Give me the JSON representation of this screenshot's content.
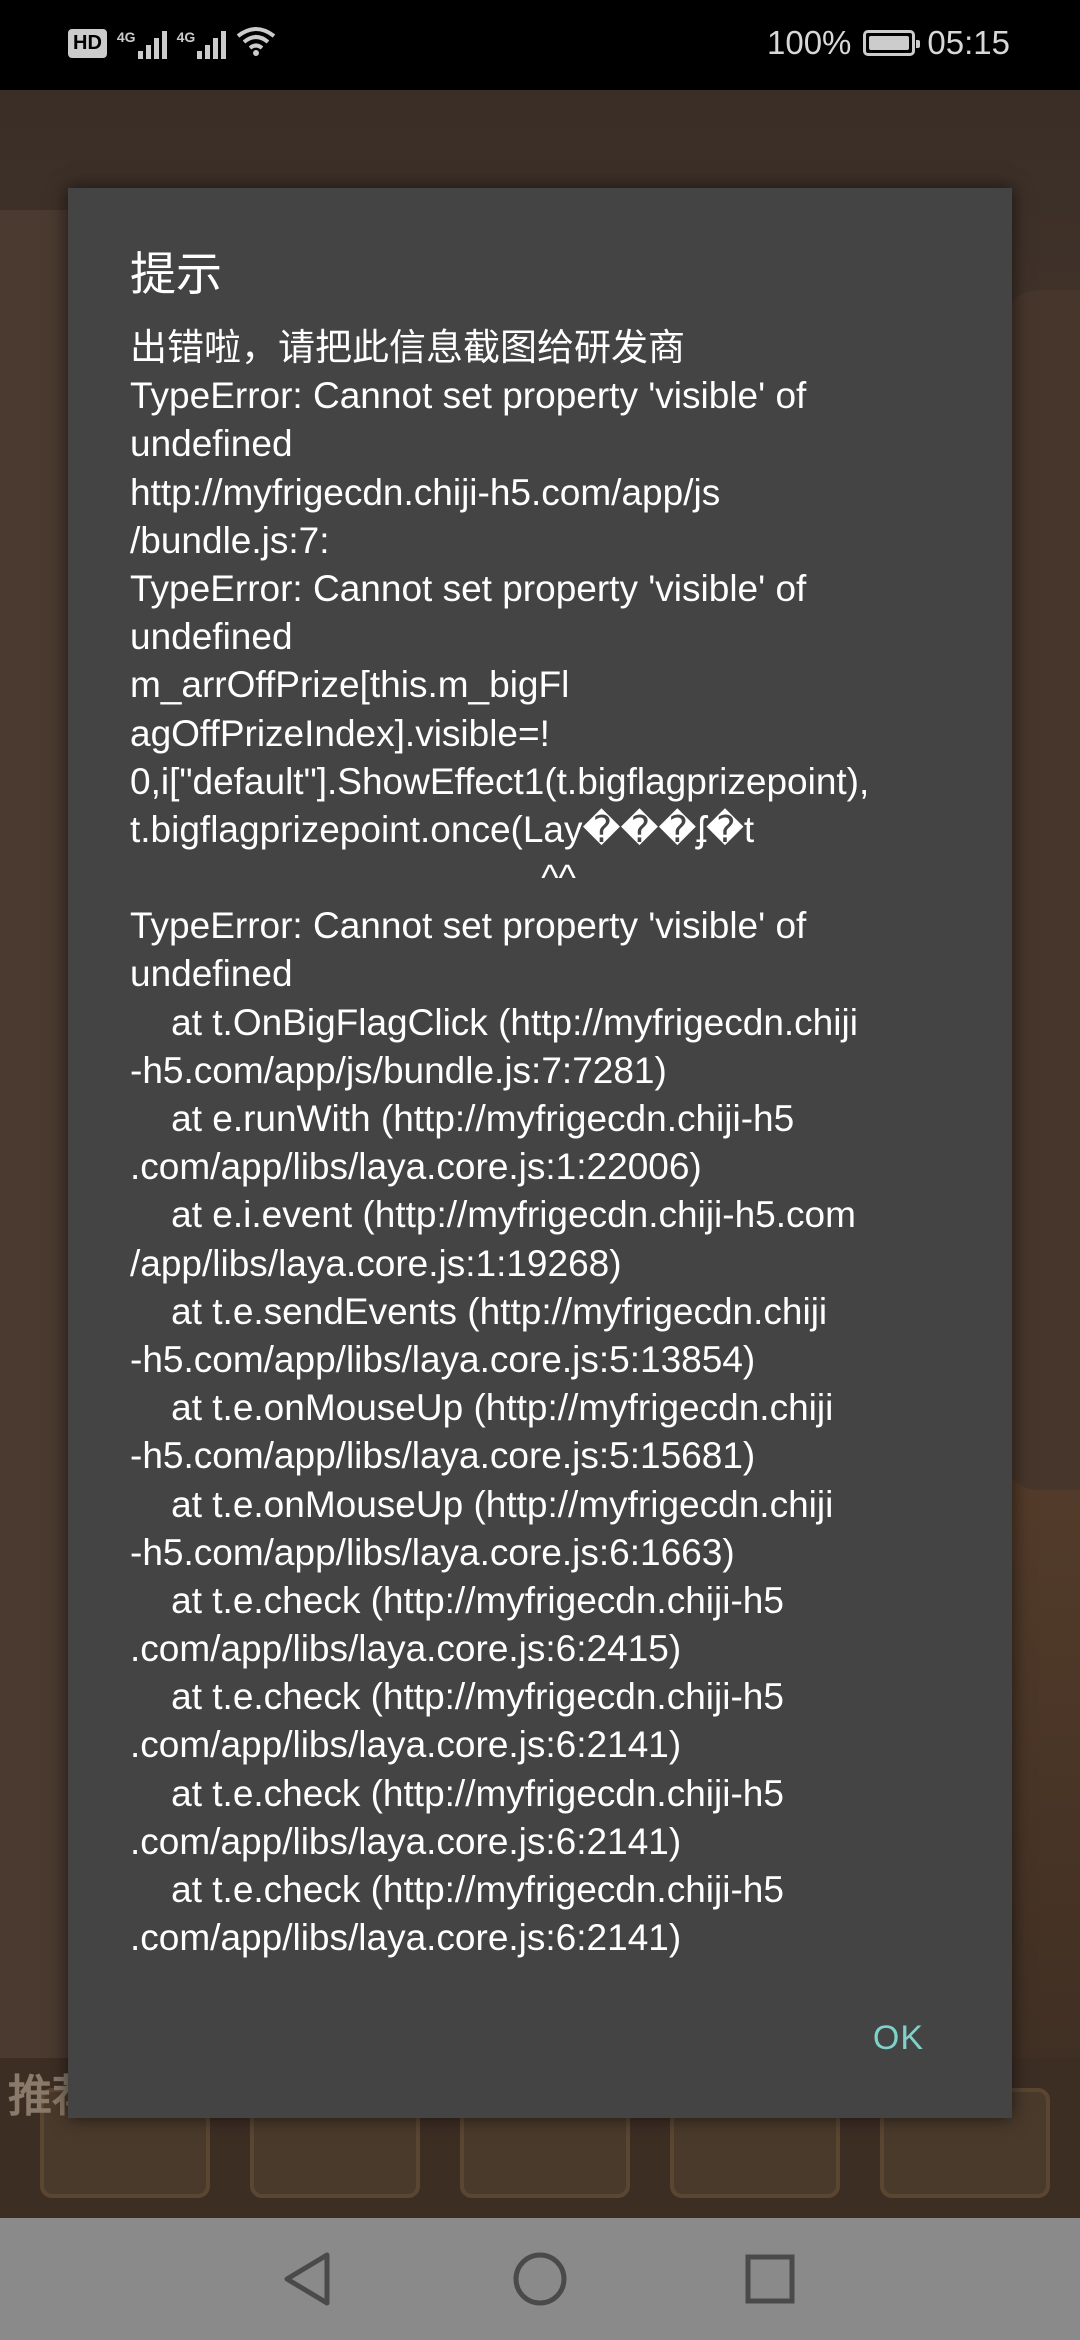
{
  "status_bar": {
    "hd_label": "HD",
    "network_labels": [
      "4G",
      "4G"
    ],
    "battery_percent": "100%",
    "time": "05:15"
  },
  "background": {
    "side_text": "推荐"
  },
  "dialog": {
    "title": "提示",
    "message_lines": [
      "出错啦，请把此信息截图给研发商",
      "TypeError: Cannot set property 'visible' of",
      "undefined",
      "http://myfrigecdn.chiji-h5.com/app/js",
      "/bundle.js:7:",
      "TypeError: Cannot set property 'visible' of",
      "undefined",
      "m_arrOffPrize[this.m_bigFl",
      "agOffPrizeIndex].visible=!",
      "0,i[\"default\"].ShowEffect1(t.bigflagprizepoint),",
      "t.bigflagprizepoint.once(Lay���ʄ�t",
      "                                        ^^",
      "TypeError: Cannot set property 'visible' of",
      "undefined",
      "    at t.OnBigFlagClick (http://myfrigecdn.chiji",
      "-h5.com/app/js/bundle.js:7:7281)",
      "    at e.runWith (http://myfrigecdn.chiji-h5",
      ".com/app/libs/laya.core.js:1:22006)",
      "    at e.i.event (http://myfrigecdn.chiji-h5.com",
      "/app/libs/laya.core.js:1:19268)",
      "    at t.e.sendEvents (http://myfrigecdn.chiji",
      "-h5.com/app/libs/laya.core.js:5:13854)",
      "    at t.e.onMouseUp (http://myfrigecdn.chiji",
      "-h5.com/app/libs/laya.core.js:5:15681)",
      "    at t.e.onMouseUp (http://myfrigecdn.chiji",
      "-h5.com/app/libs/laya.core.js:6:1663)",
      "    at t.e.check (http://myfrigecdn.chiji-h5",
      ".com/app/libs/laya.core.js:6:2415)",
      "    at t.e.check (http://myfrigecdn.chiji-h5",
      ".com/app/libs/laya.core.js:6:2141)",
      "    at t.e.check (http://myfrigecdn.chiji-h5",
      ".com/app/libs/laya.core.js:6:2141)",
      "    at t.e.check (http://myfrigecdn.chiji-h5",
      ".com/app/libs/laya.core.js:6:2141)"
    ],
    "ok_label": "OK"
  },
  "nav_bar": {
    "icons": [
      "back-icon",
      "home-icon",
      "recents-icon"
    ]
  },
  "colors": {
    "dialog_bg": "#444444",
    "accent": "#7ed2c9",
    "nav_bg": "#8a8a8a"
  }
}
